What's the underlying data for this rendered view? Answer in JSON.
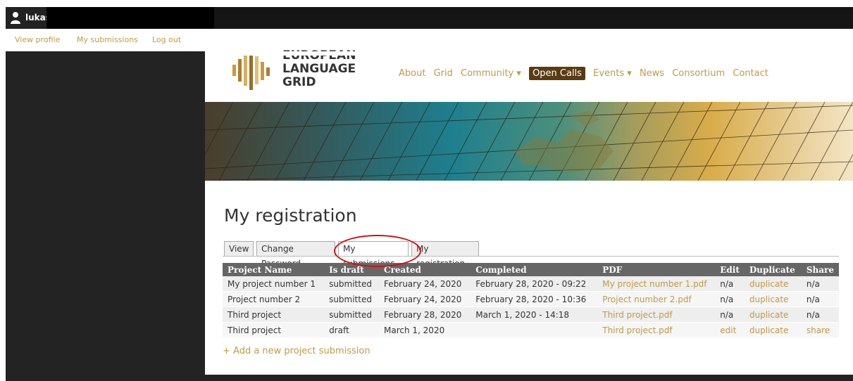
{
  "admin_bar": {
    "user_name": "lukas"
  },
  "user_links": [
    {
      "label": "View profile"
    },
    {
      "label": "My submissions"
    },
    {
      "label": "Log out"
    }
  ],
  "logo": {
    "line1": "EUROPEAN",
    "line2": "LANGUAGE",
    "line3": "GRID"
  },
  "nav": [
    {
      "label": "About"
    },
    {
      "label": "Grid"
    },
    {
      "label": "Community ▾"
    },
    {
      "label": "Open Calls"
    },
    {
      "label": "Events ▾"
    },
    {
      "label": "News"
    },
    {
      "label": "Consortium"
    },
    {
      "label": "Contact"
    }
  ],
  "page": {
    "title": "My registration"
  },
  "tabs": [
    {
      "label": "View"
    },
    {
      "label": "Change Password"
    },
    {
      "label": "My submissions"
    },
    {
      "label": "My registration"
    }
  ],
  "table": {
    "headers": [
      "Project Name",
      "Is draft",
      "Created",
      "Completed",
      "PDF",
      "Edit",
      "Duplicate",
      "Share"
    ],
    "rows": [
      {
        "name": "My project number 1",
        "draft": "submitted",
        "created": "February 24, 2020",
        "completed": "February 28, 2020 - 09:22",
        "pdf": "My project number 1.pdf",
        "edit": "n/a",
        "duplicate": "duplicate",
        "share": "n/a"
      },
      {
        "name": "Project number 2",
        "draft": "submitted",
        "created": "February 24, 2020",
        "completed": "February 28, 2020 - 10:36",
        "pdf": "Project number 2.pdf",
        "edit": "n/a",
        "duplicate": "duplicate",
        "share": "n/a"
      },
      {
        "name": "Third project",
        "draft": "submitted",
        "created": "February 28, 2020",
        "completed": "March 1, 2020 - 14:18",
        "pdf": "Third project.pdf",
        "edit": "n/a",
        "duplicate": "duplicate",
        "share": "n/a"
      },
      {
        "name": "Third project",
        "draft": "draft",
        "created": "March 1, 2020",
        "completed": "",
        "pdf": "Third project.pdf",
        "edit": "edit",
        "duplicate": "duplicate",
        "share": "share"
      }
    ]
  },
  "add_link": "+ Add a new project submission",
  "colors": {
    "accent": "#c19a44",
    "header_bg": "#666666",
    "open_calls_bg": "#5a3b12",
    "annotation": "#d01010"
  },
  "icons": [
    "user-icon"
  ]
}
